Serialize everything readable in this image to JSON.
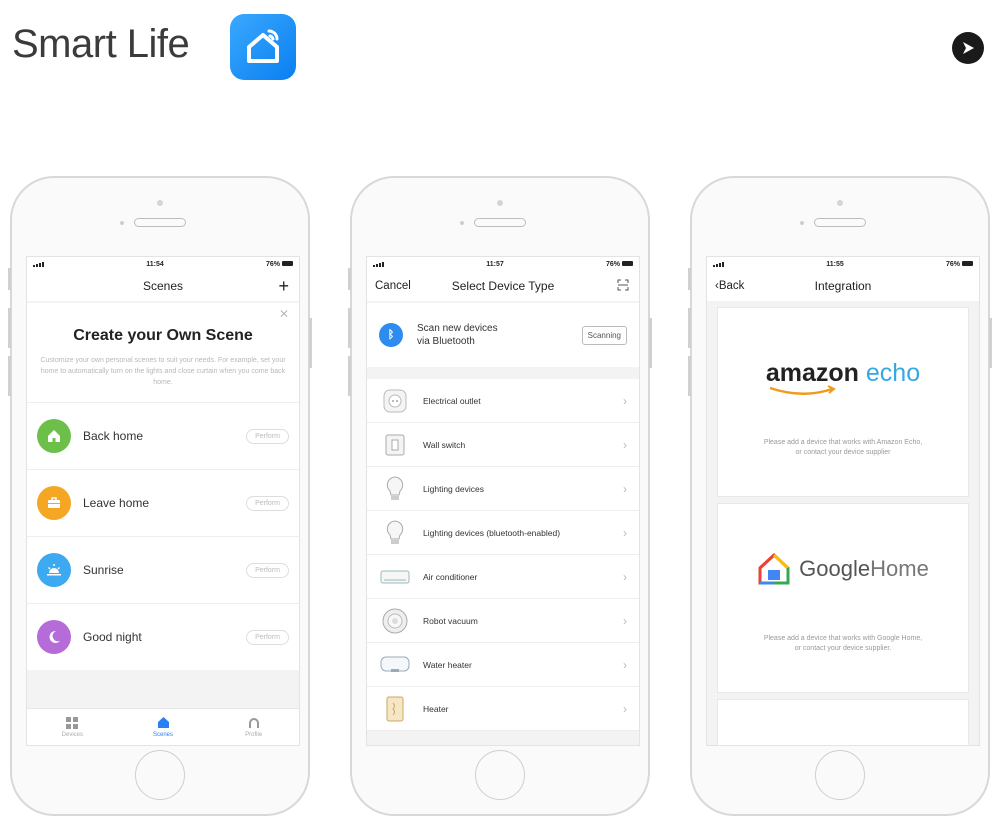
{
  "brand": {
    "title": "Smart Life"
  },
  "phones": [
    {
      "status": {
        "time": "11:54",
        "battery": "76%"
      },
      "nav": {
        "title": "Scenes",
        "right": "+"
      },
      "card": {
        "title": "Create your Own Scene",
        "desc": "Customize your own personal scenes to suit your needs. For example, set your home to automatically turn on the lights and close curtain when you come back home."
      },
      "scenes": [
        {
          "label": "Back home",
          "action": "Perform",
          "color": "#6cc04a",
          "icon": "home-icon"
        },
        {
          "label": "Leave home",
          "action": "Perform",
          "color": "#f5a623",
          "icon": "briefcase-icon"
        },
        {
          "label": "Sunrise",
          "action": "Perform",
          "color": "#3ca9f0",
          "icon": "sunrise-icon"
        },
        {
          "label": "Good night",
          "action": "Perform",
          "color": "#b56cd8",
          "icon": "moon-icon"
        }
      ],
      "tabs": [
        {
          "label": "Devices",
          "icon": "grid-icon"
        },
        {
          "label": "Scenes",
          "icon": "house-icon"
        },
        {
          "label": "Profile",
          "icon": "profile-icon"
        }
      ]
    },
    {
      "status": {
        "time": "11:57",
        "battery": "76%"
      },
      "nav": {
        "left": "Cancel",
        "title": "Select Device Type"
      },
      "bluetooth": {
        "line1": "Scan new devices",
        "line2": "via Bluetooth",
        "button": "Scanning"
      },
      "devices": [
        {
          "label": "Electrical outlet",
          "icon": "outlet-icon"
        },
        {
          "label": "Wall switch",
          "icon": "wall-switch-icon"
        },
        {
          "label": "Lighting devices",
          "icon": "bulb-icon"
        },
        {
          "label": "Lighting devices (bluetooth-enabled)",
          "icon": "bulb-icon"
        },
        {
          "label": "Air conditioner",
          "icon": "air-conditioner-icon"
        },
        {
          "label": "Robot vacuum",
          "icon": "robot-vacuum-icon"
        },
        {
          "label": "Water heater",
          "icon": "water-heater-icon"
        },
        {
          "label": "Heater",
          "icon": "heater-icon"
        }
      ]
    },
    {
      "status": {
        "time": "11:55",
        "battery": "76%"
      },
      "nav": {
        "left": "Back",
        "title": "Integration"
      },
      "integrations": [
        {
          "name_a": "amazon",
          "name_b": "echo",
          "desc1": "Please add a device that works with Amazon Echo,",
          "desc2": "or contact your device supplier"
        },
        {
          "name_a": "Google",
          "name_b": "Home",
          "desc1": "Please add a device that works with Google Home,",
          "desc2": "or contact your device supplier."
        }
      ]
    }
  ]
}
